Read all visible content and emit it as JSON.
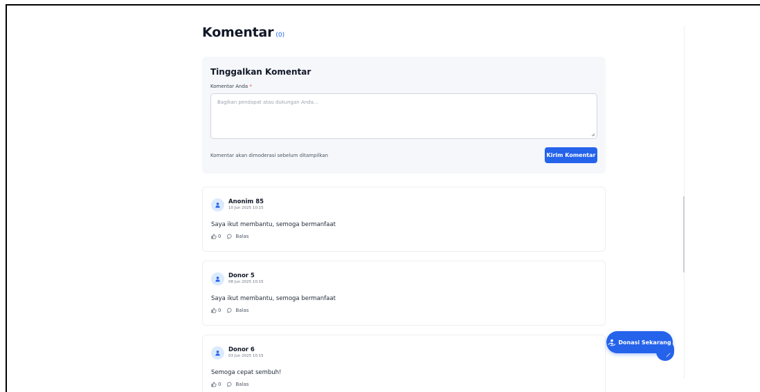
{
  "comments_section": {
    "title": "Komentar",
    "count": "(0)"
  },
  "form": {
    "title": "Tinggalkan Komentar",
    "label": "Komentar Anda",
    "required_mark": "*",
    "placeholder": "Bagikan pendapat atau dukungan Anda...",
    "note": "Komentar akan dimoderasi sebelum ditampilkan",
    "submit_label": "Kirim Komentar"
  },
  "comments": [
    {
      "name": "Anonim 85",
      "date": "10 Jun 2025 10:15",
      "text": "Saya ikut membantu, semoga bermanfaat",
      "likes": "0",
      "reply_label": "Balas"
    },
    {
      "name": "Donor 5",
      "date": "08 Jun 2025 10:15",
      "text": "Saya ikut membantu, semoga bermanfaat",
      "likes": "0",
      "reply_label": "Balas"
    },
    {
      "name": "Donor 6",
      "date": "03 Jun 2025 10:15",
      "text": "Semoga cepat sembuh!",
      "likes": "0",
      "reply_label": "Balas"
    }
  ],
  "floating": {
    "donate_label": "Donasi Sekarang"
  },
  "colors": {
    "accent": "#2563eb",
    "card_bg": "#f5f7fa",
    "required": "#ef4444"
  },
  "icons": {
    "avatar": "user-icon",
    "like": "thumbs-up-icon",
    "reply": "chat-bubble-icon",
    "donate": "hand-heart-icon"
  }
}
